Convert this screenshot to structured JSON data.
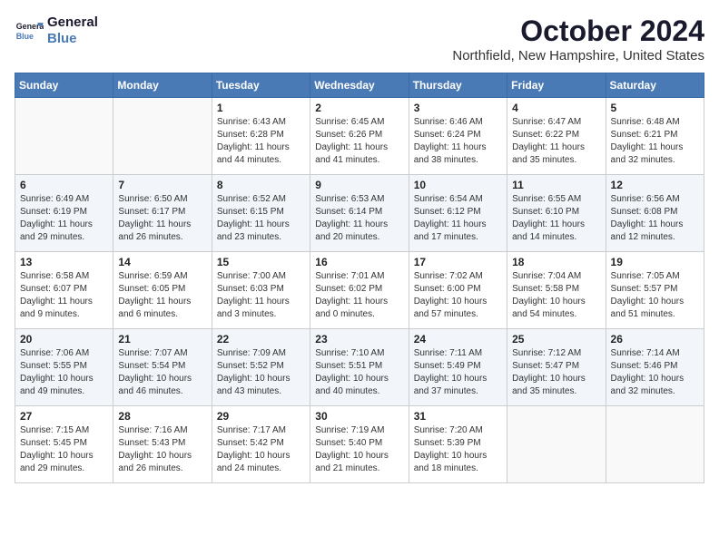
{
  "header": {
    "logo_line1": "General",
    "logo_line2": "Blue",
    "month_year": "October 2024",
    "location": "Northfield, New Hampshire, United States"
  },
  "weekdays": [
    "Sunday",
    "Monday",
    "Tuesday",
    "Wednesday",
    "Thursday",
    "Friday",
    "Saturday"
  ],
  "weeks": [
    [
      {
        "day": "",
        "empty": true
      },
      {
        "day": "",
        "empty": true
      },
      {
        "day": "1",
        "sunrise": "6:43 AM",
        "sunset": "6:28 PM",
        "daylight": "11 hours and 44 minutes."
      },
      {
        "day": "2",
        "sunrise": "6:45 AM",
        "sunset": "6:26 PM",
        "daylight": "11 hours and 41 minutes."
      },
      {
        "day": "3",
        "sunrise": "6:46 AM",
        "sunset": "6:24 PM",
        "daylight": "11 hours and 38 minutes."
      },
      {
        "day": "4",
        "sunrise": "6:47 AM",
        "sunset": "6:22 PM",
        "daylight": "11 hours and 35 minutes."
      },
      {
        "day": "5",
        "sunrise": "6:48 AM",
        "sunset": "6:21 PM",
        "daylight": "11 hours and 32 minutes."
      }
    ],
    [
      {
        "day": "6",
        "sunrise": "6:49 AM",
        "sunset": "6:19 PM",
        "daylight": "11 hours and 29 minutes."
      },
      {
        "day": "7",
        "sunrise": "6:50 AM",
        "sunset": "6:17 PM",
        "daylight": "11 hours and 26 minutes."
      },
      {
        "day": "8",
        "sunrise": "6:52 AM",
        "sunset": "6:15 PM",
        "daylight": "11 hours and 23 minutes."
      },
      {
        "day": "9",
        "sunrise": "6:53 AM",
        "sunset": "6:14 PM",
        "daylight": "11 hours and 20 minutes."
      },
      {
        "day": "10",
        "sunrise": "6:54 AM",
        "sunset": "6:12 PM",
        "daylight": "11 hours and 17 minutes."
      },
      {
        "day": "11",
        "sunrise": "6:55 AM",
        "sunset": "6:10 PM",
        "daylight": "11 hours and 14 minutes."
      },
      {
        "day": "12",
        "sunrise": "6:56 AM",
        "sunset": "6:08 PM",
        "daylight": "11 hours and 12 minutes."
      }
    ],
    [
      {
        "day": "13",
        "sunrise": "6:58 AM",
        "sunset": "6:07 PM",
        "daylight": "11 hours and 9 minutes."
      },
      {
        "day": "14",
        "sunrise": "6:59 AM",
        "sunset": "6:05 PM",
        "daylight": "11 hours and 6 minutes."
      },
      {
        "day": "15",
        "sunrise": "7:00 AM",
        "sunset": "6:03 PM",
        "daylight": "11 hours and 3 minutes."
      },
      {
        "day": "16",
        "sunrise": "7:01 AM",
        "sunset": "6:02 PM",
        "daylight": "11 hours and 0 minutes."
      },
      {
        "day": "17",
        "sunrise": "7:02 AM",
        "sunset": "6:00 PM",
        "daylight": "10 hours and 57 minutes."
      },
      {
        "day": "18",
        "sunrise": "7:04 AM",
        "sunset": "5:58 PM",
        "daylight": "10 hours and 54 minutes."
      },
      {
        "day": "19",
        "sunrise": "7:05 AM",
        "sunset": "5:57 PM",
        "daylight": "10 hours and 51 minutes."
      }
    ],
    [
      {
        "day": "20",
        "sunrise": "7:06 AM",
        "sunset": "5:55 PM",
        "daylight": "10 hours and 49 minutes."
      },
      {
        "day": "21",
        "sunrise": "7:07 AM",
        "sunset": "5:54 PM",
        "daylight": "10 hours and 46 minutes."
      },
      {
        "day": "22",
        "sunrise": "7:09 AM",
        "sunset": "5:52 PM",
        "daylight": "10 hours and 43 minutes."
      },
      {
        "day": "23",
        "sunrise": "7:10 AM",
        "sunset": "5:51 PM",
        "daylight": "10 hours and 40 minutes."
      },
      {
        "day": "24",
        "sunrise": "7:11 AM",
        "sunset": "5:49 PM",
        "daylight": "10 hours and 37 minutes."
      },
      {
        "day": "25",
        "sunrise": "7:12 AM",
        "sunset": "5:47 PM",
        "daylight": "10 hours and 35 minutes."
      },
      {
        "day": "26",
        "sunrise": "7:14 AM",
        "sunset": "5:46 PM",
        "daylight": "10 hours and 32 minutes."
      }
    ],
    [
      {
        "day": "27",
        "sunrise": "7:15 AM",
        "sunset": "5:45 PM",
        "daylight": "10 hours and 29 minutes."
      },
      {
        "day": "28",
        "sunrise": "7:16 AM",
        "sunset": "5:43 PM",
        "daylight": "10 hours and 26 minutes."
      },
      {
        "day": "29",
        "sunrise": "7:17 AM",
        "sunset": "5:42 PM",
        "daylight": "10 hours and 24 minutes."
      },
      {
        "day": "30",
        "sunrise": "7:19 AM",
        "sunset": "5:40 PM",
        "daylight": "10 hours and 21 minutes."
      },
      {
        "day": "31",
        "sunrise": "7:20 AM",
        "sunset": "5:39 PM",
        "daylight": "10 hours and 18 minutes."
      },
      {
        "day": "",
        "empty": true
      },
      {
        "day": "",
        "empty": true
      }
    ]
  ]
}
